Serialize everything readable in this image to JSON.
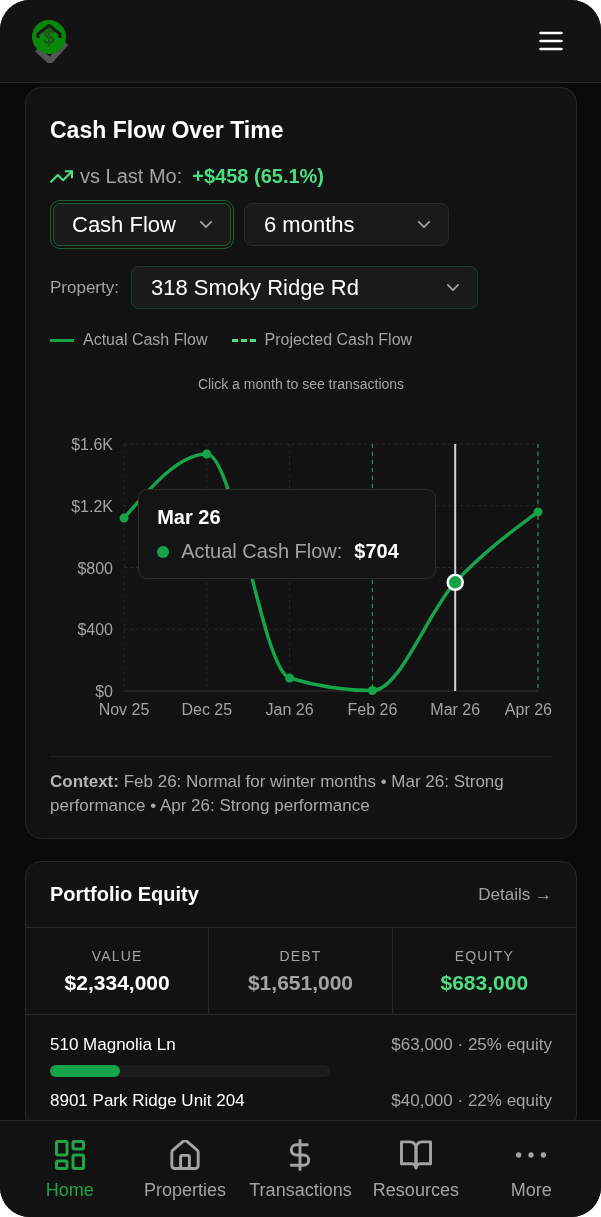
{
  "cash_flow": {
    "title": "Cash Flow Over Time",
    "change": {
      "label": "vs Last Mo:",
      "value": "+$458 (65.1%)",
      "positive": true
    },
    "filters": [
      {
        "value": "Cash Flow",
        "focused": true
      },
      {
        "value": "6 months",
        "focused": false
      }
    ],
    "property": {
      "label": "Property:",
      "value": "318 Smoky Ridge Rd"
    },
    "projected_label": "Projected Cash Flow",
    "hint": "Click a month to see transactions",
    "chart_data": {
      "type": "line",
      "categories": [
        "Nov 25",
        "Dec 25",
        "Jan 26",
        "Feb 26",
        "Mar 26",
        "Apr 26"
      ],
      "series": [
        {
          "name": "Actual Cash Flow",
          "color": "#16a34a",
          "marker": "circle",
          "values": [
            1120,
            1535,
            84,
            3,
            704,
            1160
          ]
        }
      ],
      "ylim": [
        0,
        1600
      ],
      "yticks": [
        {
          "value": 0,
          "label": "$0"
        },
        {
          "value": 400,
          "label": "$400"
        },
        {
          "value": 800,
          "label": "$800"
        },
        {
          "value": 1200,
          "label": "$1.2K"
        },
        {
          "value": 1600,
          "label": "$1.6K"
        }
      ],
      "grid": true,
      "ref_lines": [
        {
          "axis": "x",
          "value": "Feb 26",
          "color": "#1f8a43"
        },
        {
          "axis": "x",
          "value": "Mar 26",
          "color": "#d4d4d4"
        },
        {
          "axis": "x",
          "value": "Apr 26",
          "color": "#1f8a43"
        }
      ]
    },
    "tooltip": {
      "title": "Mar 26",
      "label": "Actual Cash Flow:",
      "value": "$704"
    },
    "context": "**Context:** Feb 26: Normal for winter months • Mar 26: Strong performance • Apr 26: Strong performance"
  },
  "equity": {
    "title": "Portfolio Equity",
    "link": "Details →",
    "stats": [
      {
        "label": "VALUE",
        "value": "$2,334,000",
        "color": "#ffffff"
      },
      {
        "label": "DEBT",
        "value": "$1,651,000",
        "color": "#a3a3a3"
      },
      {
        "label": "EQUITY",
        "value": "$683,000",
        "color": "#4ade80"
      }
    ],
    "properties": [
      {
        "name": "510 Magnolia Ln",
        "amount": "$63,000 · 25% equity",
        "level": 0.25
      },
      {
        "name": "8901 Park Ridge Unit 204",
        "amount": "$40,000 · 22% equity"
      }
    ]
  },
  "nav": {
    "items": [
      {
        "label": "Home",
        "selected": true
      },
      {
        "label": "Properties",
        "selected": false
      },
      {
        "label": "Transactions",
        "selected": false
      },
      {
        "label": "Resources",
        "selected": false
      },
      {
        "label": "More",
        "selected": false
      }
    ]
  }
}
